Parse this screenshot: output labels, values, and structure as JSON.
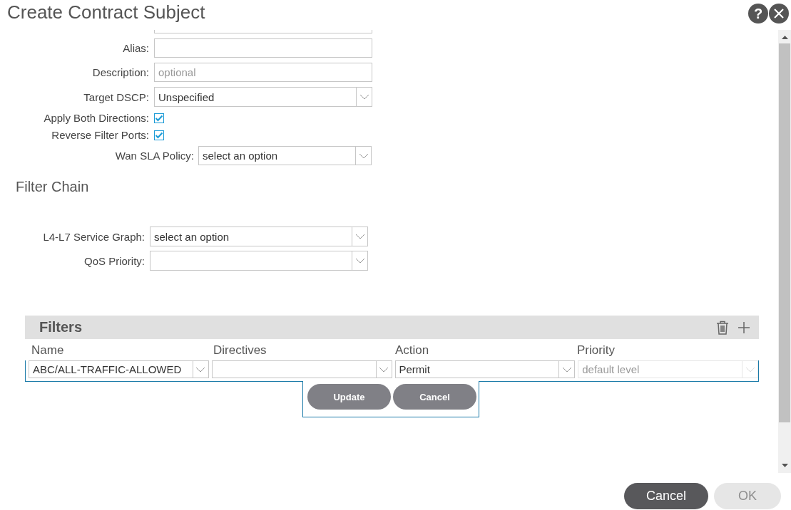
{
  "window": {
    "title": "Create Contract Subject",
    "help_icon": "?"
  },
  "fields": [
    {
      "kind": "text",
      "label": "Alias:"
    },
    {
      "kind": "text",
      "label": "Description:",
      "placeholder": "optional"
    },
    {
      "kind": "select",
      "label": "Target DSCP:",
      "value": "Unspecified"
    },
    {
      "kind": "checkbox",
      "label": "Apply Both Directions:",
      "checked": true
    },
    {
      "kind": "checkbox",
      "label": "Reverse Filter Ports:",
      "checked": true
    },
    {
      "kind": "select",
      "label": "Wan SLA Policy:",
      "value": "select an option"
    }
  ],
  "filter_chain": {
    "title": "Filter Chain",
    "fields": [
      {
        "kind": "select",
        "label": "L4-L7 Service Graph:",
        "value": "select an option"
      },
      {
        "kind": "select",
        "label": "QoS Priority:"
      }
    ]
  },
  "filters": {
    "title": "Filters",
    "columns": [
      "Name",
      "Directives",
      "Action",
      "Priority"
    ],
    "edit_row": [
      {
        "value": "ABC/ALL-TRAFFIC-ALLOWED",
        "disabled": false
      },
      {
        "disabled": false
      },
      {
        "value": "Permit",
        "disabled": false
      },
      {
        "placeholder": "default level",
        "disabled": true
      }
    ],
    "row_buttons": [
      "Update",
      "Cancel"
    ]
  },
  "footer_buttons": [
    {
      "label": "Cancel",
      "disabled": false
    },
    {
      "label": "OK",
      "disabled": true
    }
  ]
}
